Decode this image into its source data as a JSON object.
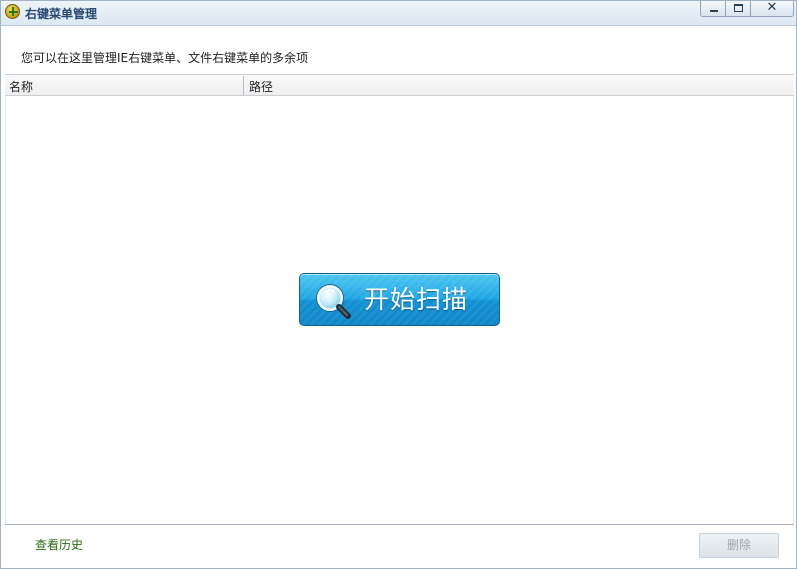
{
  "window": {
    "title": "右键菜单管理",
    "minimize_glyph": "–",
    "maximize_glyph": "□",
    "close_glyph": "✕"
  },
  "description": "您可以在这里管理IE右键菜单、文件右键菜单的多余项",
  "table": {
    "columns": [
      "名称",
      "路径"
    ],
    "rows": []
  },
  "scan_button": {
    "label": "开始扫描",
    "icon": "magnifier-icon"
  },
  "footer": {
    "history_link": "查看历史",
    "delete_label": "删除"
  },
  "colors": {
    "scan_button": "#1ea2e0",
    "history_link": "#2d6a14",
    "title_text": "#2a4a73"
  }
}
